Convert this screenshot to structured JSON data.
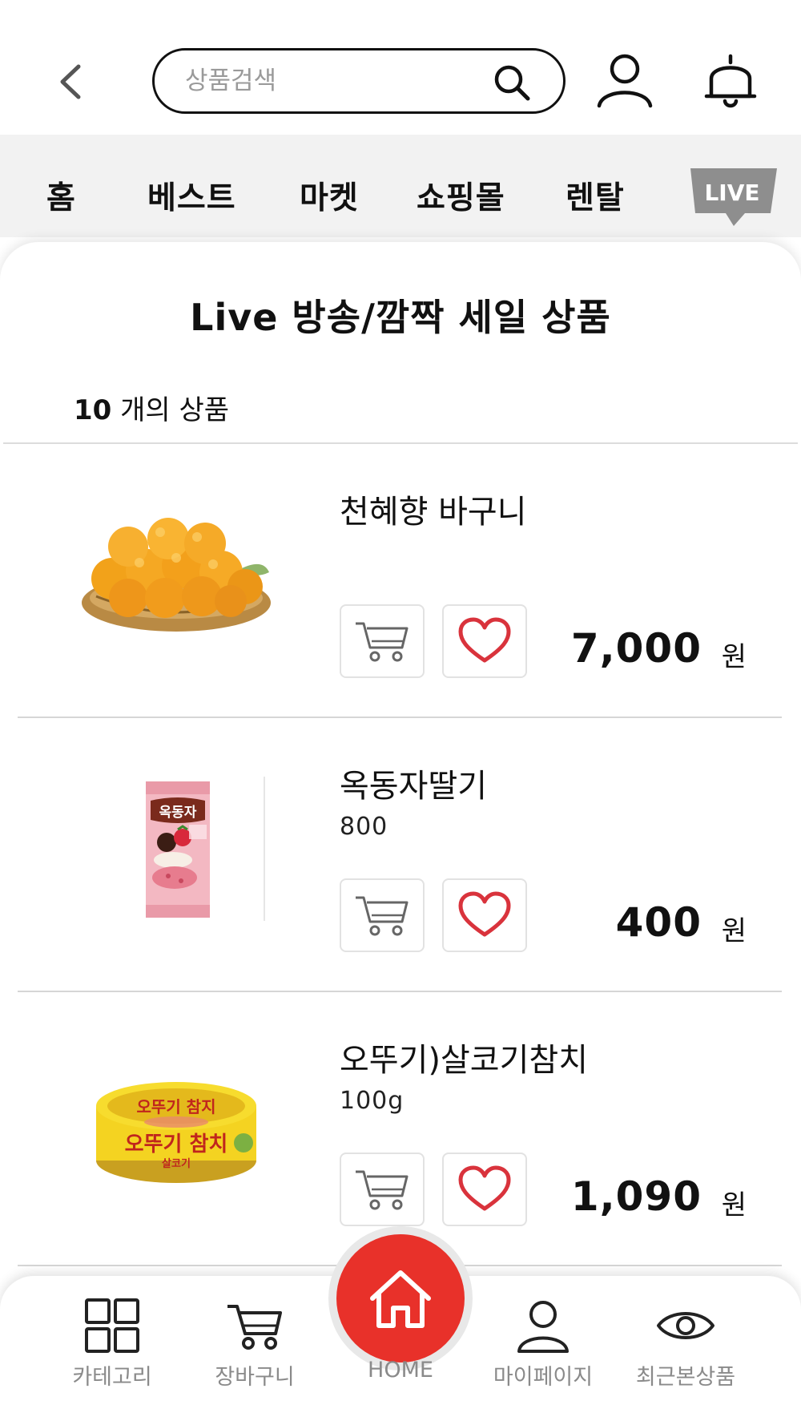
{
  "header": {
    "search_placeholder": "상품검색"
  },
  "nav": {
    "items": [
      "홈",
      "베스트",
      "마켓",
      "쇼핑몰",
      "렌탈"
    ],
    "live_label": "LIVE"
  },
  "page": {
    "title": "Live 방송/깜짝 세일 상품",
    "count_number": "10",
    "count_suffix": " 개의 상품"
  },
  "products": [
    {
      "name": "천혜향 바구니",
      "sub": "",
      "price": "7,000",
      "currency": "원",
      "image": "mandarin-basket"
    },
    {
      "name": "옥동자딸기",
      "sub": "800",
      "price": "400",
      "currency": "원",
      "image": "strawberry-ice-cream-bar"
    },
    {
      "name": "오뚜기)살코기참치",
      "sub": "100g",
      "price": "1,090",
      "currency": "원",
      "image": "tuna-can"
    }
  ],
  "product_images": {
    "can_brand_top": "오뚜기 참지",
    "can_brand_main": "오뚜기 참치",
    "can_sub": "살코기",
    "icecream_brand": "옥동자"
  },
  "bottom_nav": {
    "category": "카테고리",
    "cart": "장바구니",
    "home": "HOME",
    "mypage": "마이페이지",
    "recent": "최근본상품"
  },
  "colors": {
    "accent": "#e8312a",
    "heart": "#d9333c",
    "nav_bg": "#f2f2f2",
    "muted_text": "#8a8a8a"
  },
  "icons": [
    "back-arrow-icon",
    "search-icon",
    "user-icon",
    "bell-icon",
    "cart-icon",
    "heart-icon",
    "grid-icon",
    "home-icon",
    "eye-icon"
  ]
}
